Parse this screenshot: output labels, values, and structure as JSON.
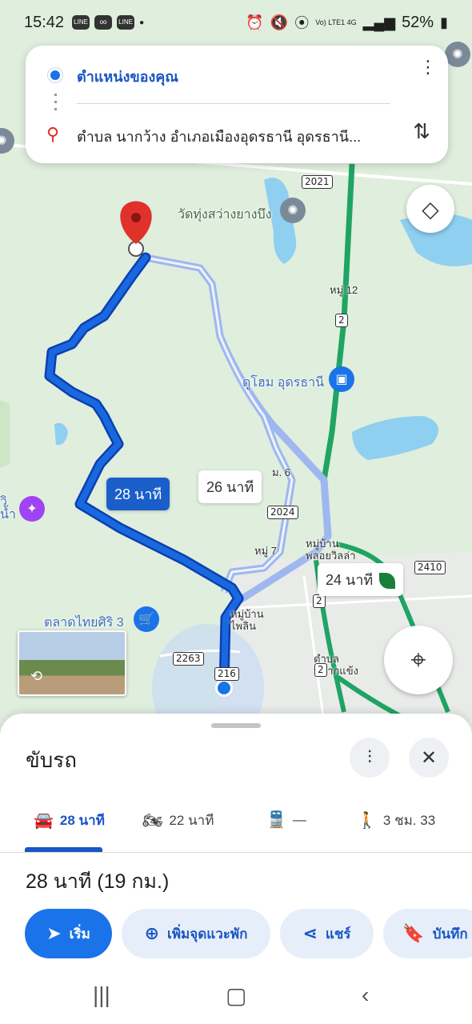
{
  "status_bar": {
    "time": "15:42",
    "battery": "52%",
    "network": "Vo) LTE1 4G"
  },
  "directions": {
    "origin": "ตำแหน่งของคุณ",
    "destination": "ตำบล นากว้าง อำเภอเมืองอุดรธานี อุดรธานี..."
  },
  "map": {
    "labels": {
      "temple": "วัดทุ่งสว่างยางบึง",
      "moo12": "หมู่ 12",
      "dhome": "ดูโฮม อุดรธานี",
      "moo6": "ม. 6",
      "moo7": "หมู่ 7",
      "village1": "หมู่บ้าน\nพลอยวิลล่า",
      "market": "ตลาดไทยศิริ 3",
      "village2": "หมู่บ้าน\nไพลิน",
      "tambon": "ตำบล\nหมากแข้ง",
      "left_edge": "วิ\nน้ำ"
    },
    "shields": [
      "2021",
      "2",
      "2024",
      "2410",
      "2",
      "2263",
      "216",
      "2"
    ],
    "route_tags": {
      "primary": "28 นาที",
      "alt1": "26 นาที",
      "alt2": "24 นาที"
    },
    "icons": {
      "layers": "layers-icon",
      "locate": "crosshair-icon"
    }
  },
  "sheet": {
    "title": "ขับรถ",
    "modes": [
      {
        "label": "28 นาที",
        "icon": "car-icon"
      },
      {
        "label": "22 นาที",
        "icon": "motorcycle-icon"
      },
      {
        "label": "—",
        "icon": "transit-icon"
      },
      {
        "label": "3 ชม. 33",
        "icon": "walk-icon"
      }
    ],
    "summary": "28 นาที (19 กม.)",
    "actions": [
      {
        "label": "เริ่ม",
        "icon": "navigate-icon"
      },
      {
        "label": "เพิ่มจุดแวะพัก",
        "icon": "add-stop-icon"
      },
      {
        "label": "แชร์",
        "icon": "share-icon"
      },
      {
        "label": "บันทึก",
        "icon": "bookmark-icon"
      }
    ]
  },
  "colors": {
    "primary_blue": "#1a73e8",
    "route_blue": "#1a5ec9",
    "highway_green": "#1fa463"
  }
}
